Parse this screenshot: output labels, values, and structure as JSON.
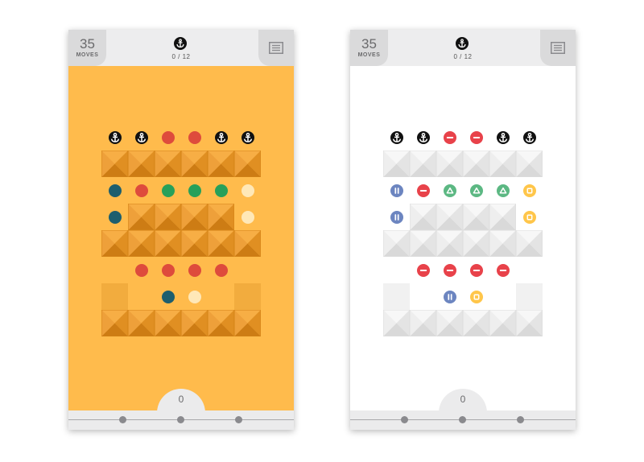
{
  "screens": [
    {
      "id": "left",
      "theme": "orange",
      "moves": "35",
      "moves_label": "MOVES",
      "goal_progress": "0 / 12",
      "bottom_label": "0"
    },
    {
      "id": "right",
      "theme": "white",
      "moves": "35",
      "moves_label": "MOVES",
      "goal_progress": "0 / 12",
      "bottom_label": "0"
    }
  ],
  "icons": {
    "goal": "anchor-icon",
    "menu": "list-icon"
  },
  "palette": {
    "orange_bg": "#ffbb4c",
    "white_bg": "#ffffff",
    "anchor": "#111111",
    "red": "#e8424a",
    "green": "#5cb883",
    "teal": "#1d5e6e",
    "cream": "#ffe8b8",
    "blue": "#6c85c0",
    "yellow": "#ffc64a",
    "orange_red": "#de4b3c",
    "orange_green": "#27a05a"
  },
  "grid": {
    "cols": 6,
    "rows": 7,
    "layout": [
      "AAAAAA",
      "TTTTTT",
      "CCCCCC",
      "CTTTTC",
      "TTTTTT",
      "EPPPPE",
      "EEPPEE",
      "TTTTTT"
    ],
    "anchors_row": [
      "anchor",
      "anchor",
      "red",
      "red",
      "anchor",
      "anchor"
    ],
    "pieces": [
      {
        "row": 2,
        "col": 0,
        "color": "teal",
        "white_color": "blue",
        "shape": "pause"
      },
      {
        "row": 2,
        "col": 1,
        "color": "red",
        "white_color": "red",
        "shape": "minus"
      },
      {
        "row": 2,
        "col": 2,
        "color": "green",
        "white_color": "green",
        "shape": "triangle"
      },
      {
        "row": 2,
        "col": 3,
        "color": "green",
        "white_color": "green",
        "shape": "triangle"
      },
      {
        "row": 2,
        "col": 4,
        "color": "green",
        "white_color": "green",
        "shape": "triangle"
      },
      {
        "row": 2,
        "col": 5,
        "color": "cream",
        "white_color": "yellow",
        "shape": "square"
      },
      {
        "row": 3,
        "col": 0,
        "color": "teal",
        "white_color": "blue",
        "shape": "pause"
      },
      {
        "row": 3,
        "col": 5,
        "color": "cream",
        "white_color": "yellow",
        "shape": "square"
      },
      {
        "row": 5,
        "col": 1,
        "color": "red",
        "white_color": "red",
        "shape": "minus"
      },
      {
        "row": 5,
        "col": 2,
        "color": "red",
        "white_color": "red",
        "shape": "minus"
      },
      {
        "row": 5,
        "col": 3,
        "color": "red",
        "white_color": "red",
        "shape": "minus"
      },
      {
        "row": 5,
        "col": 4,
        "color": "red",
        "white_color": "red",
        "shape": "minus"
      },
      {
        "row": 6,
        "col": 2,
        "color": "teal",
        "white_color": "blue",
        "shape": "pause"
      },
      {
        "row": 6,
        "col": 3,
        "color": "cream",
        "white_color": "yellow",
        "shape": "square"
      }
    ]
  }
}
